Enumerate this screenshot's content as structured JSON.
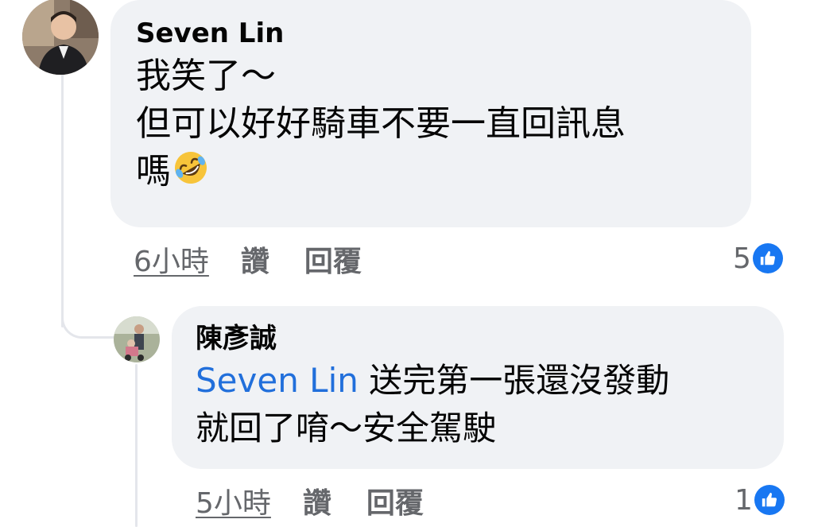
{
  "comments": [
    {
      "author": "Seven Lin",
      "lines": [
        "我笑了～",
        "但可以好好騎車不要一直回訊息",
        "嗎"
      ],
      "emoji": "rolling-on-floor-laughing-emoji",
      "time": "6小時",
      "like_label": "讚",
      "reply_label": "回覆",
      "reaction_count": "5"
    },
    {
      "author": "陳彥誠",
      "mention": "Seven Lin",
      "line1_rest": " 送完第一張還沒發動",
      "line2": "就回了唷～安全駕駛",
      "time": "5小時",
      "like_label": "讚",
      "reply_label": "回覆",
      "reaction_count": "1"
    }
  ],
  "colors": {
    "bubble": "#f0f2f5",
    "meta_text": "#65676b",
    "mention": "#216fdb",
    "like_blue": "#1877f2",
    "thread_line": "#e4e6eb"
  }
}
